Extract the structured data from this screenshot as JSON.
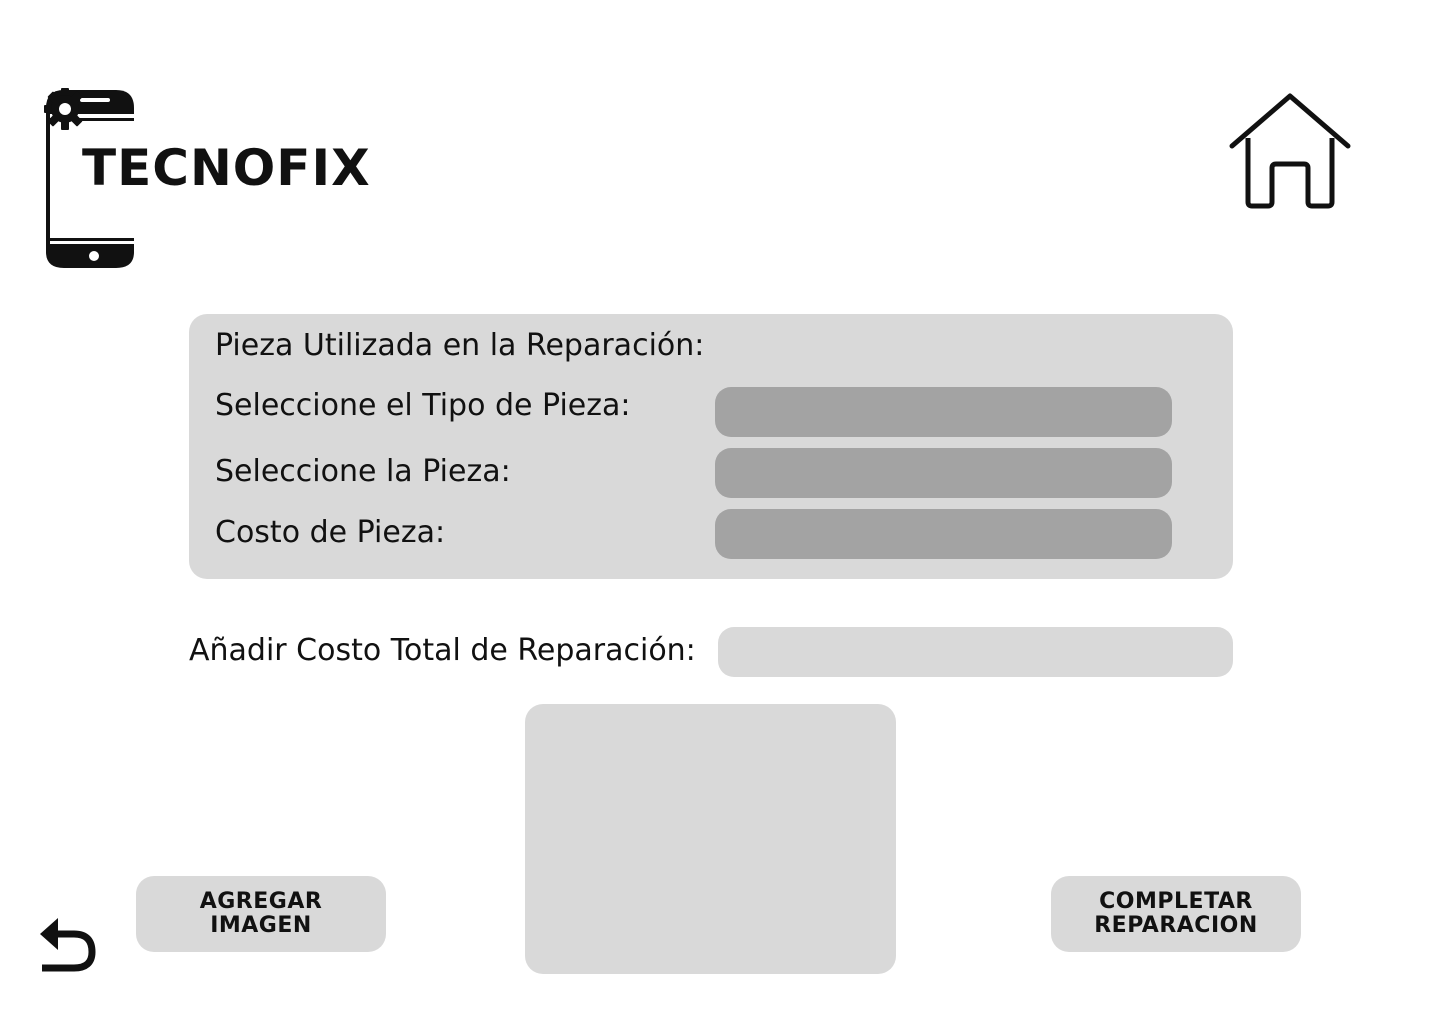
{
  "brand": {
    "name": "TECNOFIX",
    "logo_icon": "smartphone-icon",
    "gear_icon": "gear-icon"
  },
  "header": {
    "home_icon": "home-icon"
  },
  "parts": {
    "title": "Pieza Utilizada en la Reparación:",
    "type_label": "Seleccione el Tipo de Pieza:",
    "type_value": "",
    "part_label": "Seleccione la Pieza:",
    "part_value": "",
    "cost_label": "Costo de Pieza:",
    "cost_value": ""
  },
  "total": {
    "label": "Añadir Costo Total de Reparación:",
    "value": ""
  },
  "actions": {
    "add_image_line1": "AGREGAR",
    "add_image_line2": "IMAGEN",
    "complete_line1": "COMPLETAR",
    "complete_line2": "REPARACION",
    "back_icon": "undo-arrow-icon"
  },
  "colors": {
    "panel": "#d9d9d9",
    "field": "#a3a3a3",
    "text": "#111111"
  }
}
